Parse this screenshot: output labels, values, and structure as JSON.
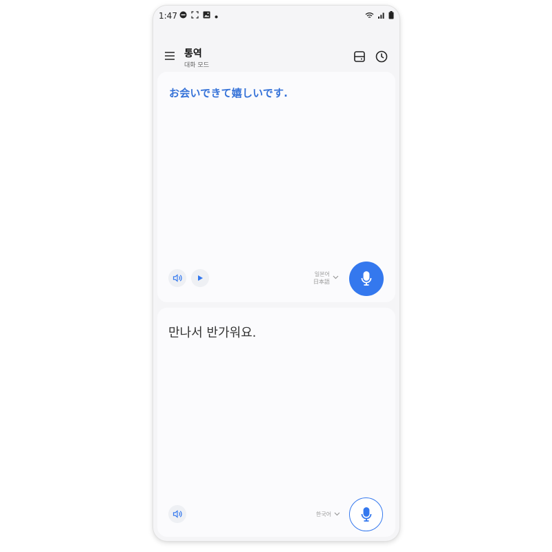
{
  "status_bar": {
    "time": "1:47",
    "icons_left": [
      "do-not-disturb-icon",
      "screenshot-icon",
      "gallery-icon",
      "dot-icon"
    ],
    "icons_right": [
      "wifi-icon",
      "signal-icon",
      "battery-icon"
    ]
  },
  "header": {
    "title": "통역",
    "subtitle": "대화 모드",
    "icons": [
      "menu-icon",
      "layout-toggle-icon",
      "history-icon"
    ]
  },
  "top_panel": {
    "text": "お会いできて嬉しいです.",
    "language_line1": "일본어",
    "language_line2": "日本語",
    "icons": [
      "speaker-icon",
      "play-icon",
      "chevron-down-icon",
      "microphone-icon"
    ],
    "accent_color": "#3478ee",
    "text_color": "#3572d8"
  },
  "bottom_panel": {
    "text": "만나서 반가워요.",
    "language": "한국어",
    "icons": [
      "speaker-icon",
      "chevron-down-icon",
      "microphone-icon"
    ]
  }
}
